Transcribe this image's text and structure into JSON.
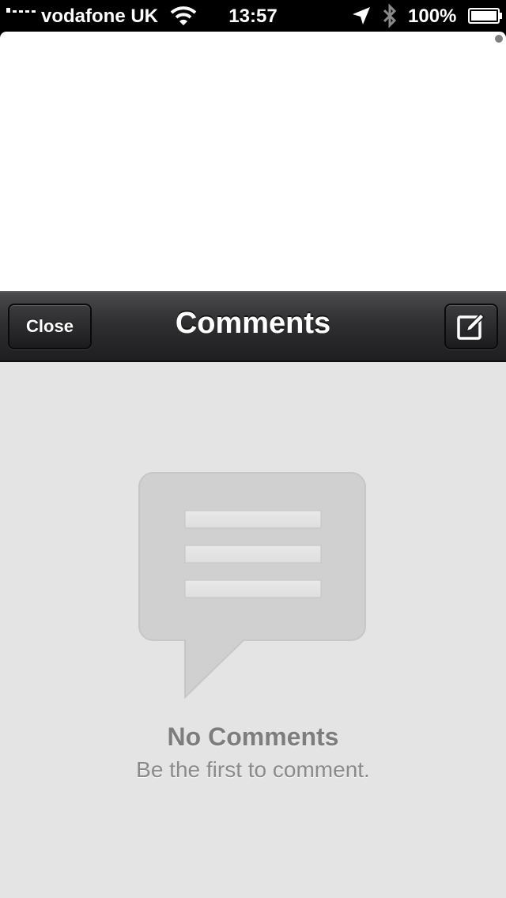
{
  "status_bar": {
    "carrier": "vodafone UK",
    "time": "13:57",
    "battery_percent": "100%",
    "signal_icon": "signal-bars-icon",
    "wifi_icon": "wifi-icon",
    "location_icon": "location-arrow-icon",
    "bluetooth_icon": "bluetooth-icon",
    "battery_icon": "battery-icon"
  },
  "nav": {
    "title": "Comments",
    "close_label": "Close",
    "compose_icon": "compose-icon"
  },
  "empty_state": {
    "icon": "speech-bubble-icon",
    "title": "No Comments",
    "subtitle": "Be the first to comment."
  },
  "colors": {
    "nav_bar": "#2f2f31",
    "body_background": "#e4e4e4",
    "top_area": "#ffffff"
  }
}
